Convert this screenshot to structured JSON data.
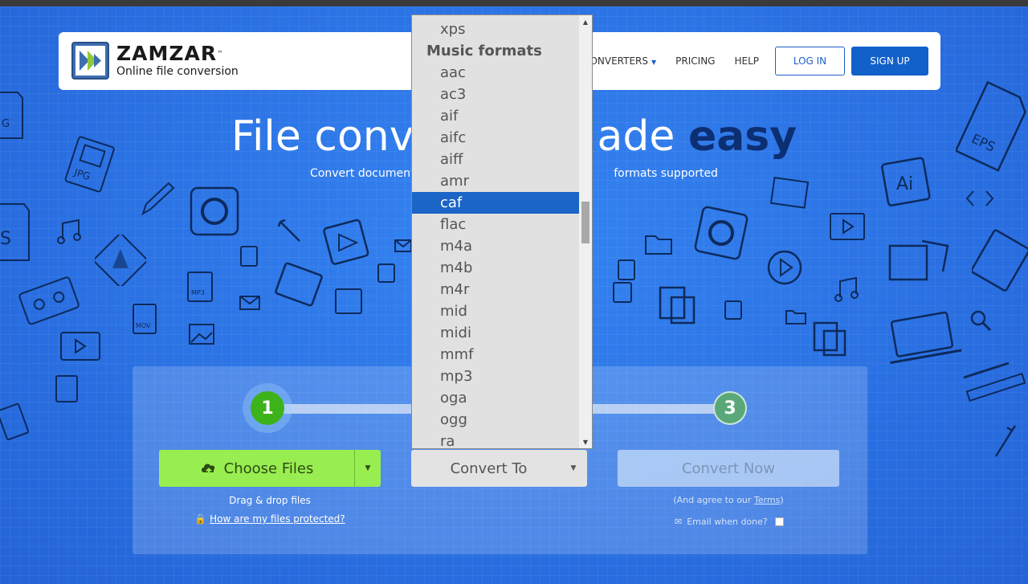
{
  "brand": {
    "name": "ZAMZAR",
    "tm": "™",
    "tagline": "Online file conversion"
  },
  "nav": {
    "converters": "CONVERTERS",
    "pricing": "PRICING",
    "help": "HELP",
    "login": "LOG IN",
    "signup": "SIGN UP"
  },
  "hero": {
    "title_left": "File conv",
    "title_right": "ade ",
    "title_em": "easy",
    "subtitle_left": "Convert documents,",
    "subtitle_right": "formats supported"
  },
  "converter": {
    "step1": "1",
    "step3": "3",
    "choose_files": "Choose Files",
    "drag_drop": "Drag & drop files",
    "protect_link": "How are my files protected?",
    "convert_to": "Convert To",
    "convert_now": "Convert Now",
    "agree_prefix": "(And agree to our ",
    "agree_link": "Terms",
    "agree_suffix": ")",
    "email_label": "Email when done?"
  },
  "format_dropdown": {
    "items": [
      {
        "label": "xps",
        "type": "item"
      },
      {
        "label": "Music formats",
        "type": "group"
      },
      {
        "label": "aac",
        "type": "item"
      },
      {
        "label": "ac3",
        "type": "item"
      },
      {
        "label": "aif",
        "type": "item"
      },
      {
        "label": "aifc",
        "type": "item"
      },
      {
        "label": "aiff",
        "type": "item"
      },
      {
        "label": "amr",
        "type": "item"
      },
      {
        "label": "caf",
        "type": "item",
        "selected": true
      },
      {
        "label": "flac",
        "type": "item"
      },
      {
        "label": "m4a",
        "type": "item"
      },
      {
        "label": "m4b",
        "type": "item"
      },
      {
        "label": "m4r",
        "type": "item"
      },
      {
        "label": "mid",
        "type": "item"
      },
      {
        "label": "midi",
        "type": "item"
      },
      {
        "label": "mmf",
        "type": "item"
      },
      {
        "label": "mp3",
        "type": "item"
      },
      {
        "label": "oga",
        "type": "item"
      },
      {
        "label": "ogg",
        "type": "item"
      },
      {
        "label": "ra",
        "type": "item"
      }
    ]
  },
  "colors": {
    "background": "#2b74e6",
    "accent": "#1260c9",
    "choose_green": "#98ee50",
    "selected_item": "#1a65c6"
  }
}
